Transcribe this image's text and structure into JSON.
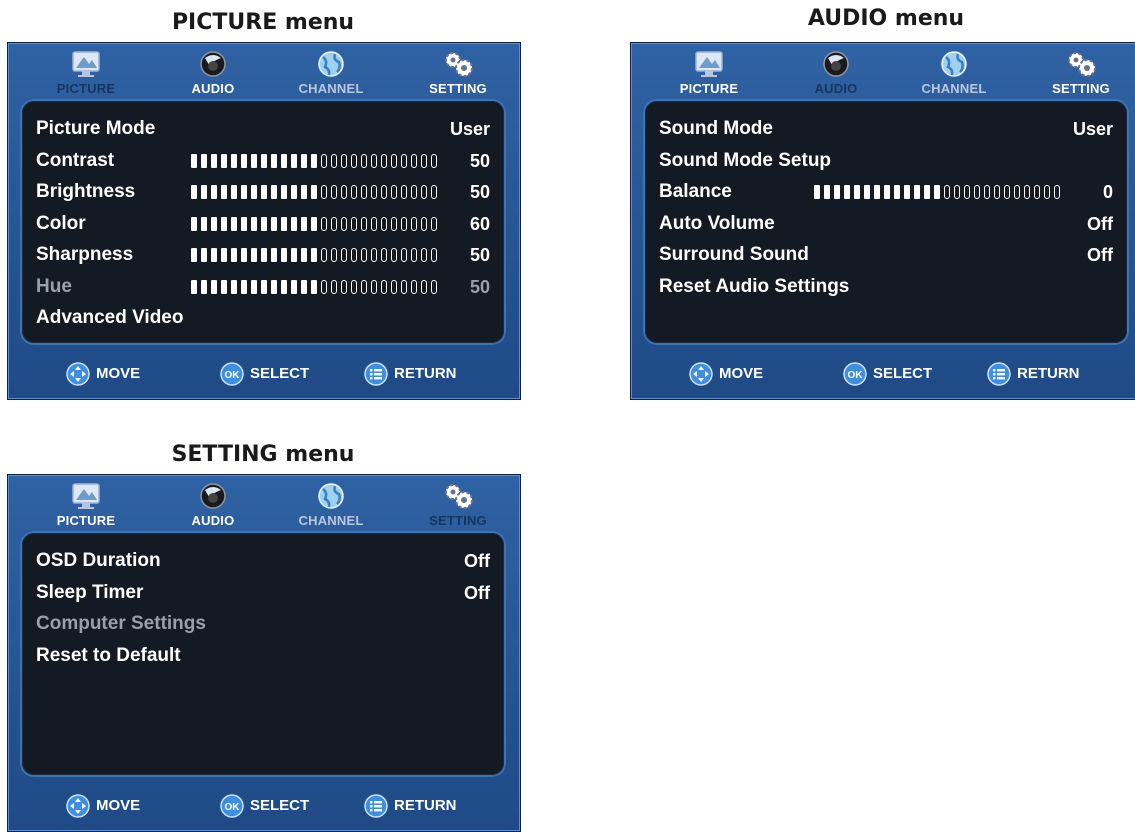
{
  "captions": {
    "picture": "PICTURE menu",
    "audio": "AUDIO menu",
    "setting": "SETTING menu"
  },
  "tabs": {
    "picture": "PICTURE",
    "audio": "AUDIO",
    "channel": "CHANNEL",
    "setting": "SETTING"
  },
  "footer": {
    "move": "MOVE",
    "select": "SELECT",
    "return": "RETURN",
    "ok_icon_text": "OK"
  },
  "colors": {
    "osd_blue": "#2f62a4",
    "panel_dark": "#141a24",
    "text_white": "#ffffff",
    "text_disabled": "#9aa0aa"
  },
  "picture_menu": {
    "active_tab": "picture",
    "items": [
      {
        "label": "Picture Mode",
        "value": "User"
      },
      {
        "label": "Contrast",
        "value": "50",
        "level": 0.5
      },
      {
        "label": "Brightness",
        "value": "50",
        "level": 0.5
      },
      {
        "label": "Color",
        "value": "60",
        "level": 0.5
      },
      {
        "label": "Sharpness",
        "value": "50",
        "level": 0.5
      },
      {
        "label": "Hue",
        "value": "50",
        "level": 0.5,
        "disabled": true
      },
      {
        "label": "Advanced Video"
      }
    ]
  },
  "audio_menu": {
    "active_tab": "audio",
    "items": [
      {
        "label": "Sound Mode",
        "value": "User"
      },
      {
        "label": "Sound Mode Setup"
      },
      {
        "label": "Balance",
        "value": "0",
        "level": 0.5
      },
      {
        "label": "Auto Volume",
        "value": "Off"
      },
      {
        "label": "Surround Sound",
        "value": "Off"
      },
      {
        "label": "Reset Audio Settings"
      }
    ]
  },
  "setting_menu": {
    "active_tab": "setting",
    "items": [
      {
        "label": "OSD Duration",
        "value": "Off"
      },
      {
        "label": "Sleep Timer",
        "value": "Off"
      },
      {
        "label": "Computer Settings",
        "disabled": true
      },
      {
        "label": "Reset to Default"
      }
    ]
  }
}
